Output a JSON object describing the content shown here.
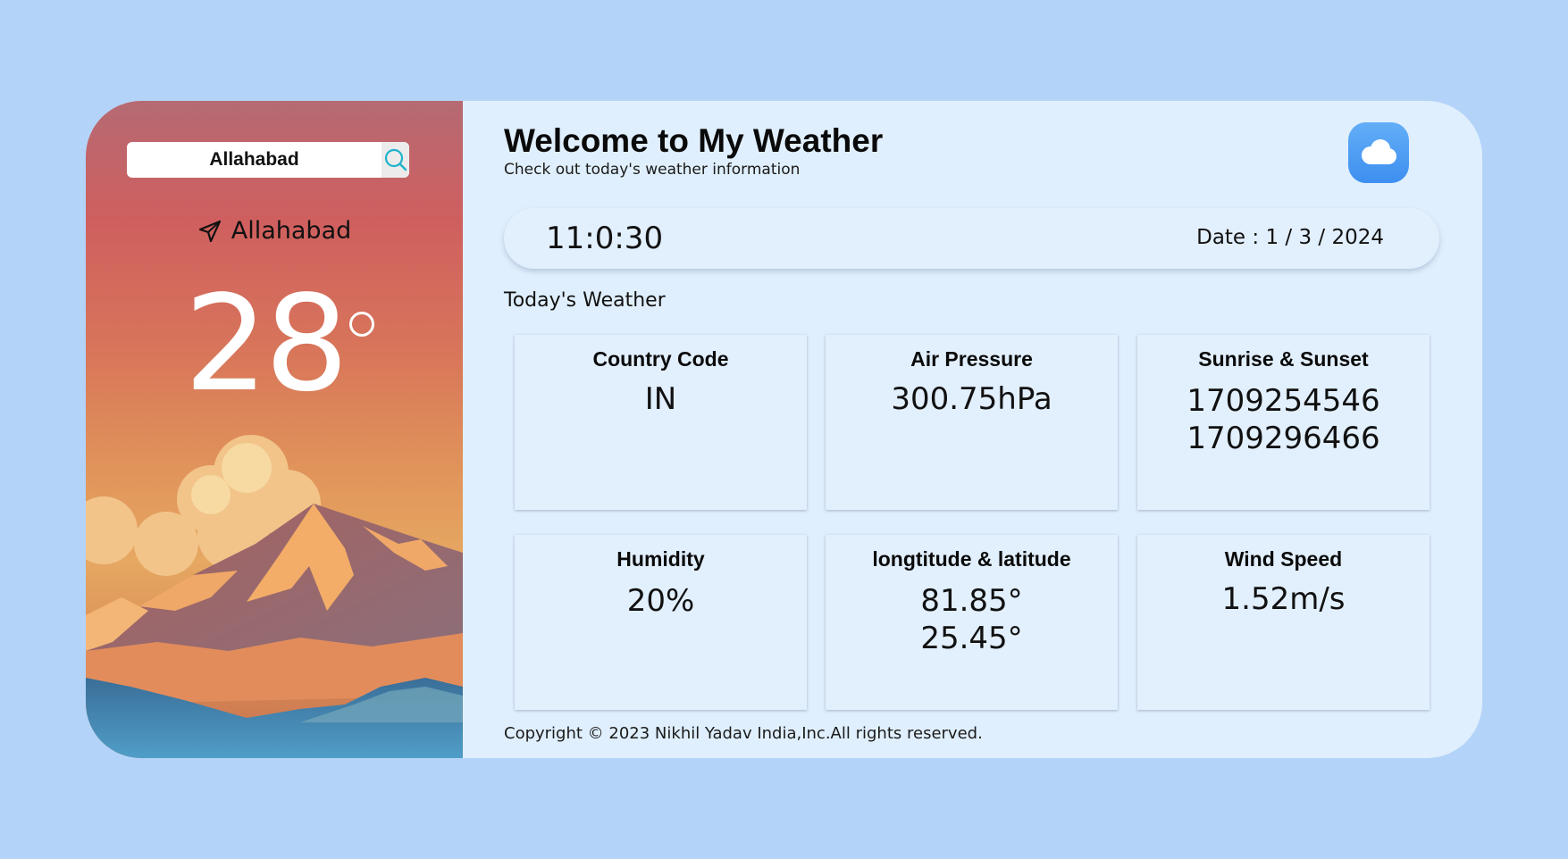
{
  "search": {
    "value": "Allahabad"
  },
  "location": {
    "name": "Allahabad"
  },
  "temperature": {
    "value": "28"
  },
  "header": {
    "title": "Welcome to My Weather",
    "subtitle": "Check out today's weather information"
  },
  "clock": {
    "time": "11:0:30",
    "date": "Date : 1 / 3 / 2024"
  },
  "section_label": "Today's Weather",
  "cards": {
    "country": {
      "title": "Country Code",
      "value": "IN"
    },
    "pressure": {
      "title": "Air Pressure",
      "value": "300.75hPa"
    },
    "sun": {
      "title": "Sunrise & Sunset",
      "sunrise": "1709254546",
      "sunset": "1709296466"
    },
    "humidity": {
      "title": "Humidity",
      "value": "20%"
    },
    "coords": {
      "title": "longtitude & latitude",
      "longitude": "81.85°",
      "latitude": "25.45°"
    },
    "wind": {
      "title": "Wind Speed",
      "value": "1.52m/s"
    }
  },
  "footer": {
    "copyright": "Copyright © 2023 Nikhil Yadav India,Inc.All rights reserved."
  },
  "icons": {
    "search": "search-icon",
    "location": "paper-plane-icon",
    "cloud": "cloud-icon"
  },
  "colors": {
    "page_background": "#b3d4f8",
    "panel_background": "#e0effd",
    "accent_blue": "#3d8ff0",
    "search_icon": "#1fb3c9"
  }
}
